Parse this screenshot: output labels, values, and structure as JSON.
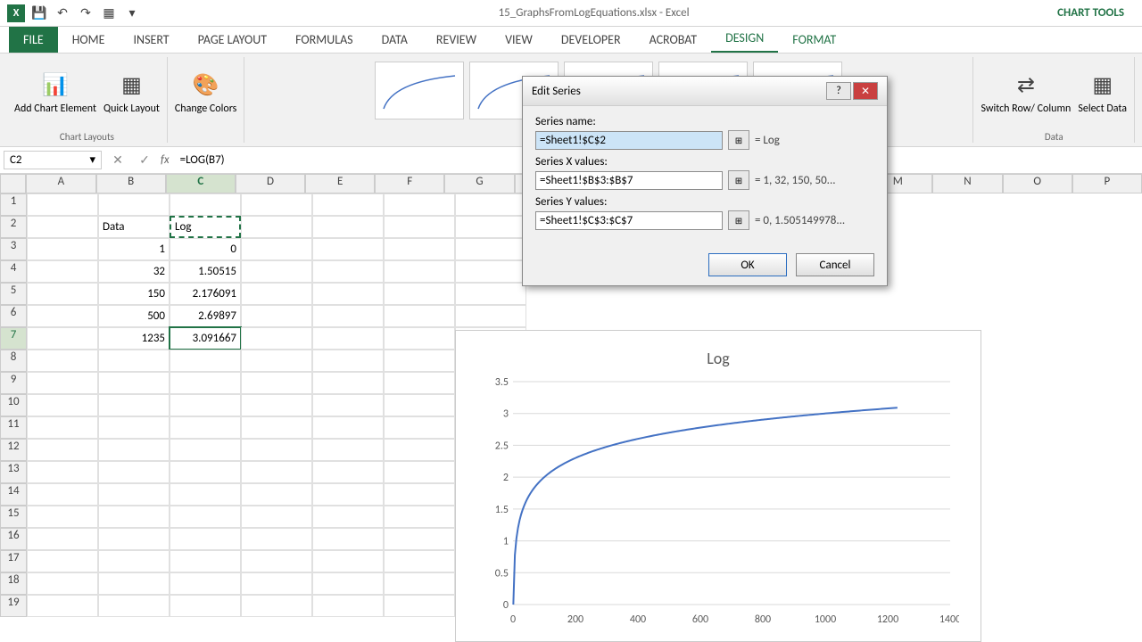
{
  "title": "15_GraphsFromLogEquations.xlsx - Excel",
  "chart_tools": "CHART TOOLS",
  "tabs": {
    "file": "FILE",
    "home": "HOME",
    "insert": "INSERT",
    "pagelayout": "PAGE LAYOUT",
    "formulas": "FORMULAS",
    "data": "DATA",
    "review": "REVIEW",
    "view": "VIEW",
    "developer": "DEVELOPER",
    "acrobat": "ACROBAT",
    "design": "DESIGN",
    "format": "FORMAT"
  },
  "ribbon": {
    "add_chart": "Add Chart Element",
    "quick_layout": "Quick Layout",
    "change_colors": "Change Colors",
    "chart_layouts": "Chart Layouts",
    "data_group": "Data",
    "switch": "Switch Row/ Column",
    "select": "Select Data"
  },
  "name_box": "C2",
  "formula": "=LOG(B7)",
  "columns": [
    "A",
    "B",
    "C",
    "D",
    "E",
    "F",
    "G",
    "",
    "M",
    "N",
    "O",
    "P"
  ],
  "rows_labels": [
    "1",
    "2",
    "3",
    "4",
    "5",
    "6",
    "7",
    "8",
    "9",
    "10",
    "11",
    "12",
    "13",
    "14",
    "15",
    "16",
    "17",
    "18",
    "19"
  ],
  "cells": {
    "B2": "Data",
    "C2": "Log",
    "B3": "1",
    "C3": "0",
    "B4": "32",
    "C4": "1.50515",
    "B5": "150",
    "C5": "2.176091",
    "B6": "500",
    "C6": "2.69897",
    "B7": "1235",
    "C7": "3.091667"
  },
  "dialog": {
    "title": "Edit Series",
    "series_name_label": "Series name:",
    "series_name_value": "=Sheet1!$C$2",
    "series_name_result": "= Log",
    "series_x_label": "Series X values:",
    "series_x_value": "=Sheet1!$B$3:$B$7",
    "series_x_result": "= 1, 32, 150, 50...",
    "series_y_label": "Series Y values:",
    "series_y_value": "=Sheet1!$C$3:$C$7",
    "series_y_result": "= 0, 1.505149978...",
    "ok": "OK",
    "cancel": "Cancel"
  },
  "chart_data": {
    "type": "line",
    "title": "Log",
    "x": [
      1,
      32,
      150,
      500,
      1235
    ],
    "y": [
      0,
      1.50515,
      2.176091,
      2.69897,
      3.091667
    ],
    "xlabel": "",
    "ylabel": "",
    "xlim": [
      0,
      1400
    ],
    "ylim": [
      0,
      3.5
    ],
    "xticks": [
      0,
      200,
      400,
      600,
      800,
      1000,
      1200,
      1400
    ],
    "yticks": [
      0,
      0.5,
      1,
      1.5,
      2,
      2.5,
      3,
      3.5
    ]
  }
}
